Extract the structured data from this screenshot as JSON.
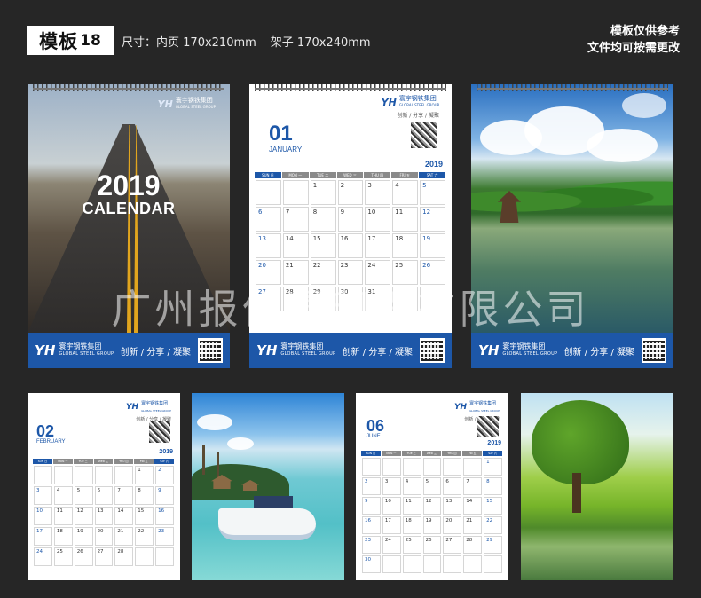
{
  "header": {
    "badge_main": "模板",
    "badge_num": "18",
    "spec_label": "尺寸：",
    "spec_inner": "内页  170x210mm",
    "spec_stand": "架子  170x240mm",
    "note_line1": "模板仅供参考",
    "note_line2": "文件均可按需更改"
  },
  "brand": {
    "logo": "YH",
    "name_cn": "寰宇钢铁集团",
    "name_en": "GLOBAL STEEL GROUP",
    "slogan": "创新 / 分享 / 凝聚"
  },
  "cover": {
    "year": "2019",
    "title": "CALENDAR"
  },
  "weekdays": [
    "SUN 日",
    "MON 一",
    "TUE 二",
    "WED 三",
    "THU 四",
    "FRI 五",
    "SAT 六"
  ],
  "months": {
    "jan": {
      "num": "01",
      "name": "JANUARY",
      "year": "2019",
      "days": [
        "",
        "",
        "1",
        "2",
        "3",
        "4",
        "5",
        "6",
        "7",
        "8",
        "9",
        "10",
        "11",
        "12",
        "13",
        "14",
        "15",
        "16",
        "17",
        "18",
        "19",
        "20",
        "21",
        "22",
        "23",
        "24",
        "25",
        "26",
        "27",
        "28",
        "29",
        "30",
        "31",
        "",
        ""
      ]
    },
    "feb": {
      "num": "02",
      "name": "FEBRUARY",
      "year": "2019",
      "days": [
        "",
        "",
        "",
        "",
        "",
        "1",
        "2",
        "3",
        "4",
        "5",
        "6",
        "7",
        "8",
        "9",
        "10",
        "11",
        "12",
        "13",
        "14",
        "15",
        "16",
        "17",
        "18",
        "19",
        "20",
        "21",
        "22",
        "23",
        "24",
        "25",
        "26",
        "27",
        "28",
        "",
        ""
      ]
    },
    "jun": {
      "num": "06",
      "name": "JUNE",
      "year": "2019",
      "days": [
        "",
        "",
        "",
        "",
        "",
        "",
        "1",
        "2",
        "3",
        "4",
        "5",
        "6",
        "7",
        "8",
        "9",
        "10",
        "11",
        "12",
        "13",
        "14",
        "15",
        "16",
        "17",
        "18",
        "19",
        "20",
        "21",
        "22",
        "23",
        "24",
        "25",
        "26",
        "27",
        "28",
        "29",
        "30",
        "",
        "",
        "",
        "",
        "",
        ""
      ]
    }
  },
  "watermark": "广州报价通印刷有限公司"
}
